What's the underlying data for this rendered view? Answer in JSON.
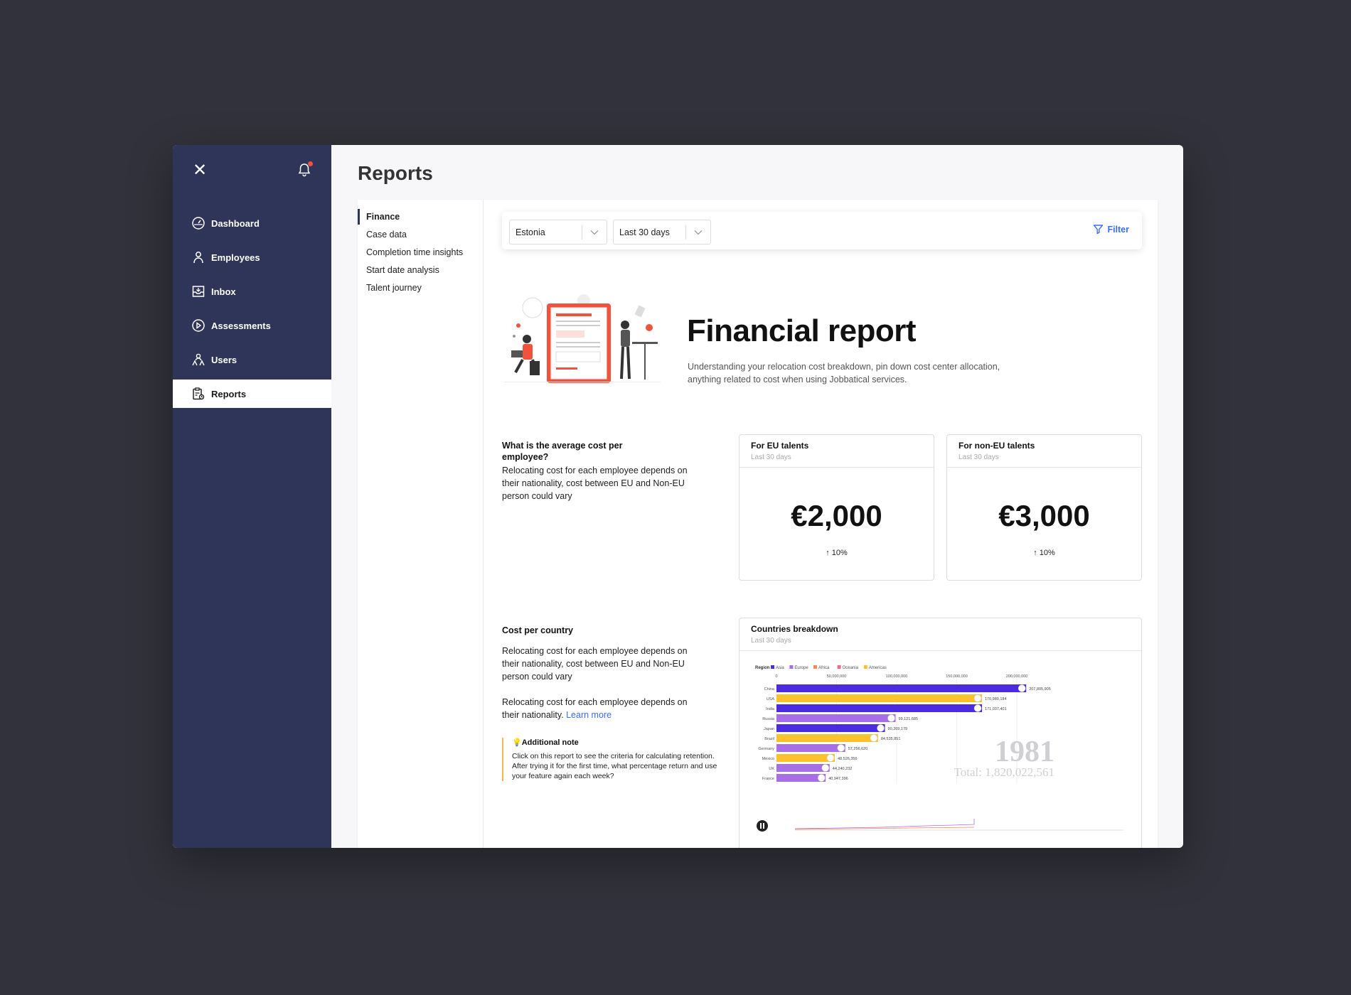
{
  "sidebar": {
    "items": [
      {
        "label": "Dashboard",
        "icon": "dashboard-icon"
      },
      {
        "label": "Employees",
        "icon": "person-icon"
      },
      {
        "label": "Inbox",
        "icon": "inbox-icon"
      },
      {
        "label": "Assessments",
        "icon": "play-circle-icon"
      },
      {
        "label": "Users",
        "icon": "users-icon"
      },
      {
        "label": "Reports",
        "icon": "clipboard-icon"
      }
    ],
    "active": "Reports"
  },
  "page": {
    "title": "Reports"
  },
  "subnav": {
    "items": [
      "Finance",
      "Case data",
      "Completion time insights",
      "Start date analysis",
      "Talent journey"
    ],
    "active": "Finance"
  },
  "filters": {
    "country": "Estonia",
    "period": "Last 30 days",
    "filter_label": "Filter"
  },
  "hero": {
    "title": "Financial report",
    "description": "Understanding your relocation cost breakdown, pin down cost center allocation, anything related to cost when using Jobbatical services."
  },
  "avg_cost": {
    "question": "What is the average cost per employee?",
    "body": "Relocating cost for each employee depends on their nationality,  cost between EU and Non-EU person could vary",
    "eu": {
      "title": "For EU talents",
      "sub": "Last 30 days",
      "value": "€2,000",
      "trend": "↑ 10%"
    },
    "non_eu": {
      "title": "For non-EU talents",
      "sub": "Last 30 days",
      "value": "€3,000",
      "trend": "↑ 10%"
    }
  },
  "country_cost": {
    "title": "Cost per country",
    "body1": "Relocating cost for each employee depends on their nationality,  cost between EU and Non-EU person could vary",
    "body2": "Relocating cost for each employee depends on their nationality.",
    "link": "Learn more",
    "note_title": "💡Additional note",
    "note_body": "Click on this report to see the criteria for calculating retention. After trying it for the first time, what percentage return and use your feature again each week?"
  },
  "breakdown": {
    "title": "Countries breakdown",
    "sub": "Last 30 days"
  },
  "colors": {
    "asia": "#4b2be0",
    "europe": "#a86ee8",
    "africa": "#f08a5a",
    "oceania": "#f06a8a",
    "americas": "#fbc22e",
    "accent": "#3b6ef5",
    "sidebar": "#2f3558"
  },
  "chart_data": {
    "type": "bar",
    "orientation": "horizontal",
    "legend_title": "Region",
    "legend": [
      {
        "name": "Asia",
        "color": "#4b2be0"
      },
      {
        "name": "Europe",
        "color": "#a86ee8"
      },
      {
        "name": "Africa",
        "color": "#f08a5a"
      },
      {
        "name": "Oceania",
        "color": "#f06a8a"
      },
      {
        "name": "Americas",
        "color": "#fbc22e"
      }
    ],
    "categories": [
      "China",
      "USA",
      "India",
      "Russia",
      "Japan",
      "Brazil",
      "Germany",
      "Mexico",
      "UK",
      "France"
    ],
    "values": [
      207805905,
      170980184,
      171037401,
      99121685,
      90269179,
      84535851,
      57256620,
      48526356,
      44240232,
      40947396
    ],
    "value_labels": [
      "207,805,905",
      "170,980,184",
      "171,037,401",
      "99,121,685",
      "90,269,179",
      "84,535,851",
      "57,256,620",
      "48,526,356",
      "44,240,232",
      "40,947,396"
    ],
    "regions": [
      "asia",
      "americas",
      "asia",
      "europe",
      "asia",
      "americas",
      "europe",
      "americas",
      "europe",
      "europe"
    ],
    "x_ticks": [
      "0",
      "50,000,000",
      "100,000,000",
      "150,000,000",
      "200,000,000"
    ],
    "xlim": [
      0,
      200000000
    ],
    "year": "1981",
    "total": "Total: 1,820,022,561"
  }
}
